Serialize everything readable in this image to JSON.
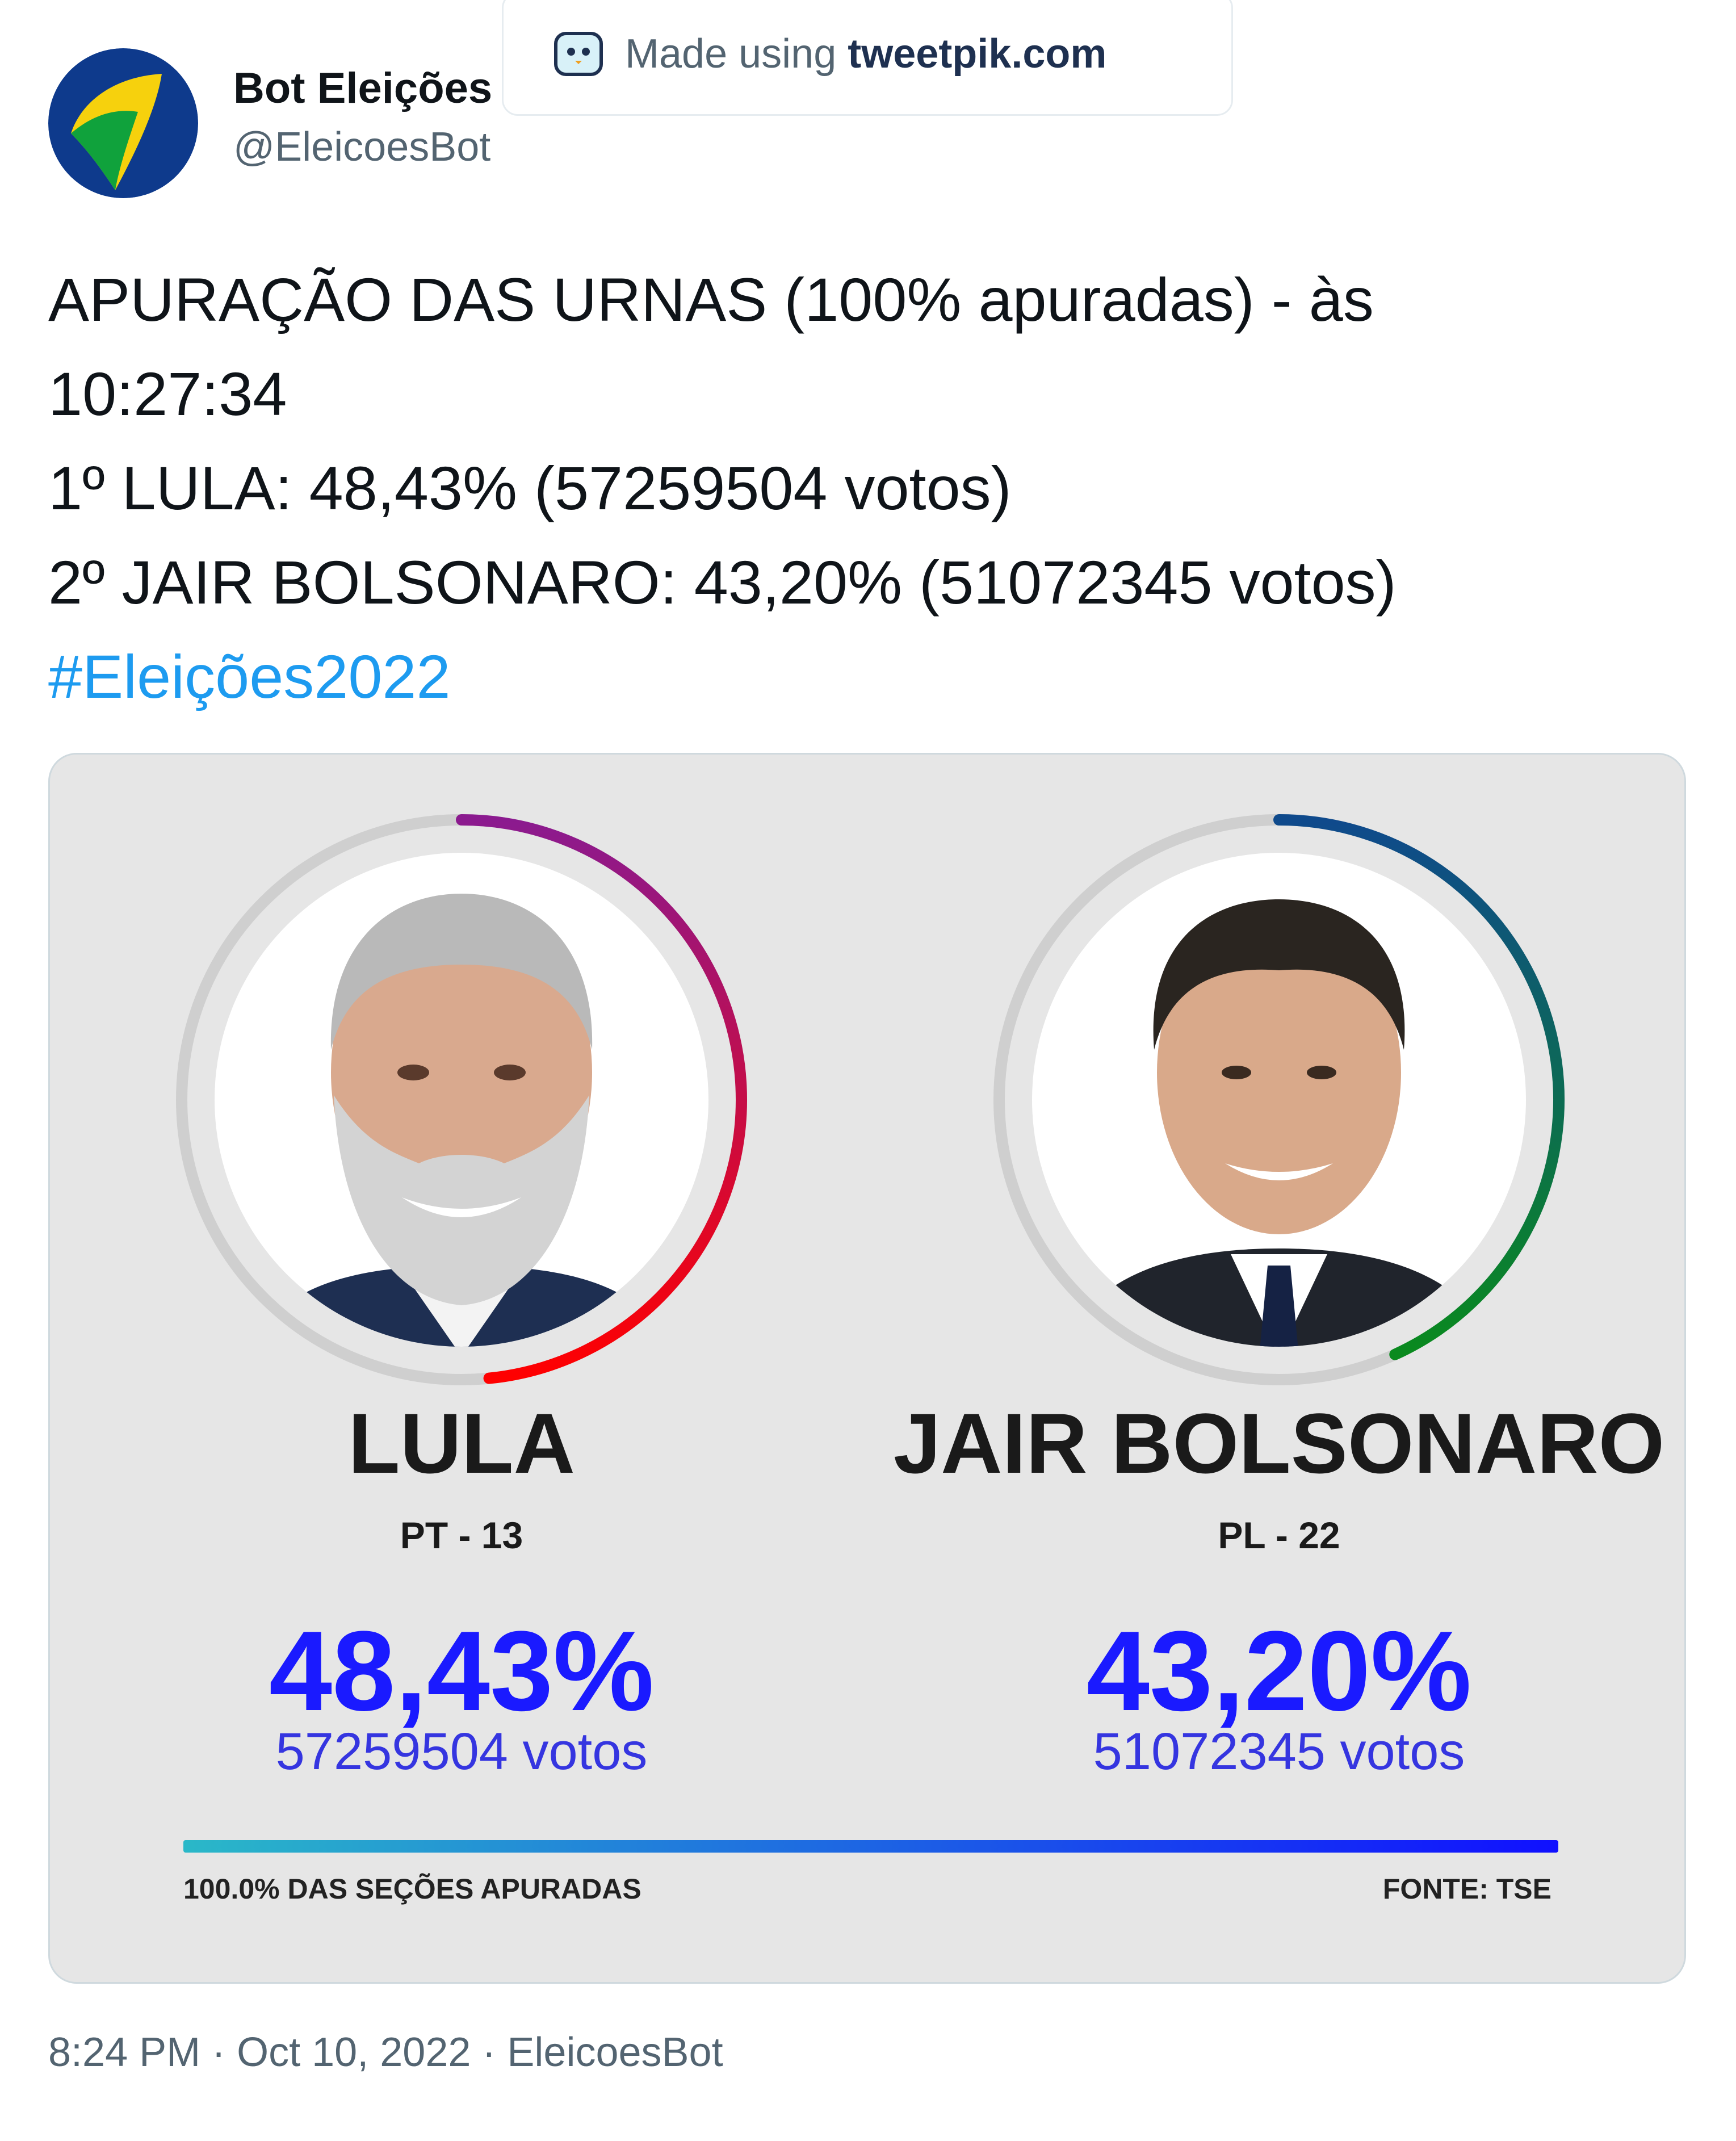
{
  "tweet": {
    "author_name": "Bot Eleições",
    "author_handle": "@EleicoesBot",
    "text_lines": [
      "APURAÇÃO DAS URNAS (100% apuradas) - às",
      "10:27:34",
      "1º LULA: 48,43% (57259504 votos)",
      "2º JAIR BOLSONARO: 43,20% (51072345 votos)"
    ],
    "hashtag": "#Eleições2022",
    "timestamp": "8:24 PM · Oct 10, 2022 · EleicoesBot"
  },
  "watermark": {
    "prefix": "Made using",
    "brand": "tweetpik.com"
  },
  "card": {
    "candidates": [
      {
        "name": "LULA",
        "party": "PT - 13",
        "percent_label": "48,43%",
        "votes_label": "57259504 votos",
        "vote_share": 0.4843,
        "arc_colors": [
          "#8b1a8f",
          "#ff0000"
        ]
      },
      {
        "name": "JAIR BOLSONARO",
        "party": "PL - 22",
        "percent_label": "43,20%",
        "votes_label": "51072345 votos",
        "vote_share": 0.432,
        "arc_colors": [
          "#0f4a8c",
          "#0a8a1e"
        ]
      }
    ],
    "progress_label": "100.0% DAS SEÇÕES APURADAS",
    "progress": 1.0,
    "source_label": "FONTE: TSE",
    "colors": {
      "percent": "#1a1aff",
      "votes": "#3535e0",
      "progress_start": "#2ab8c8",
      "progress_end": "#1010ff",
      "ring_track": "#cfcfcf"
    }
  }
}
